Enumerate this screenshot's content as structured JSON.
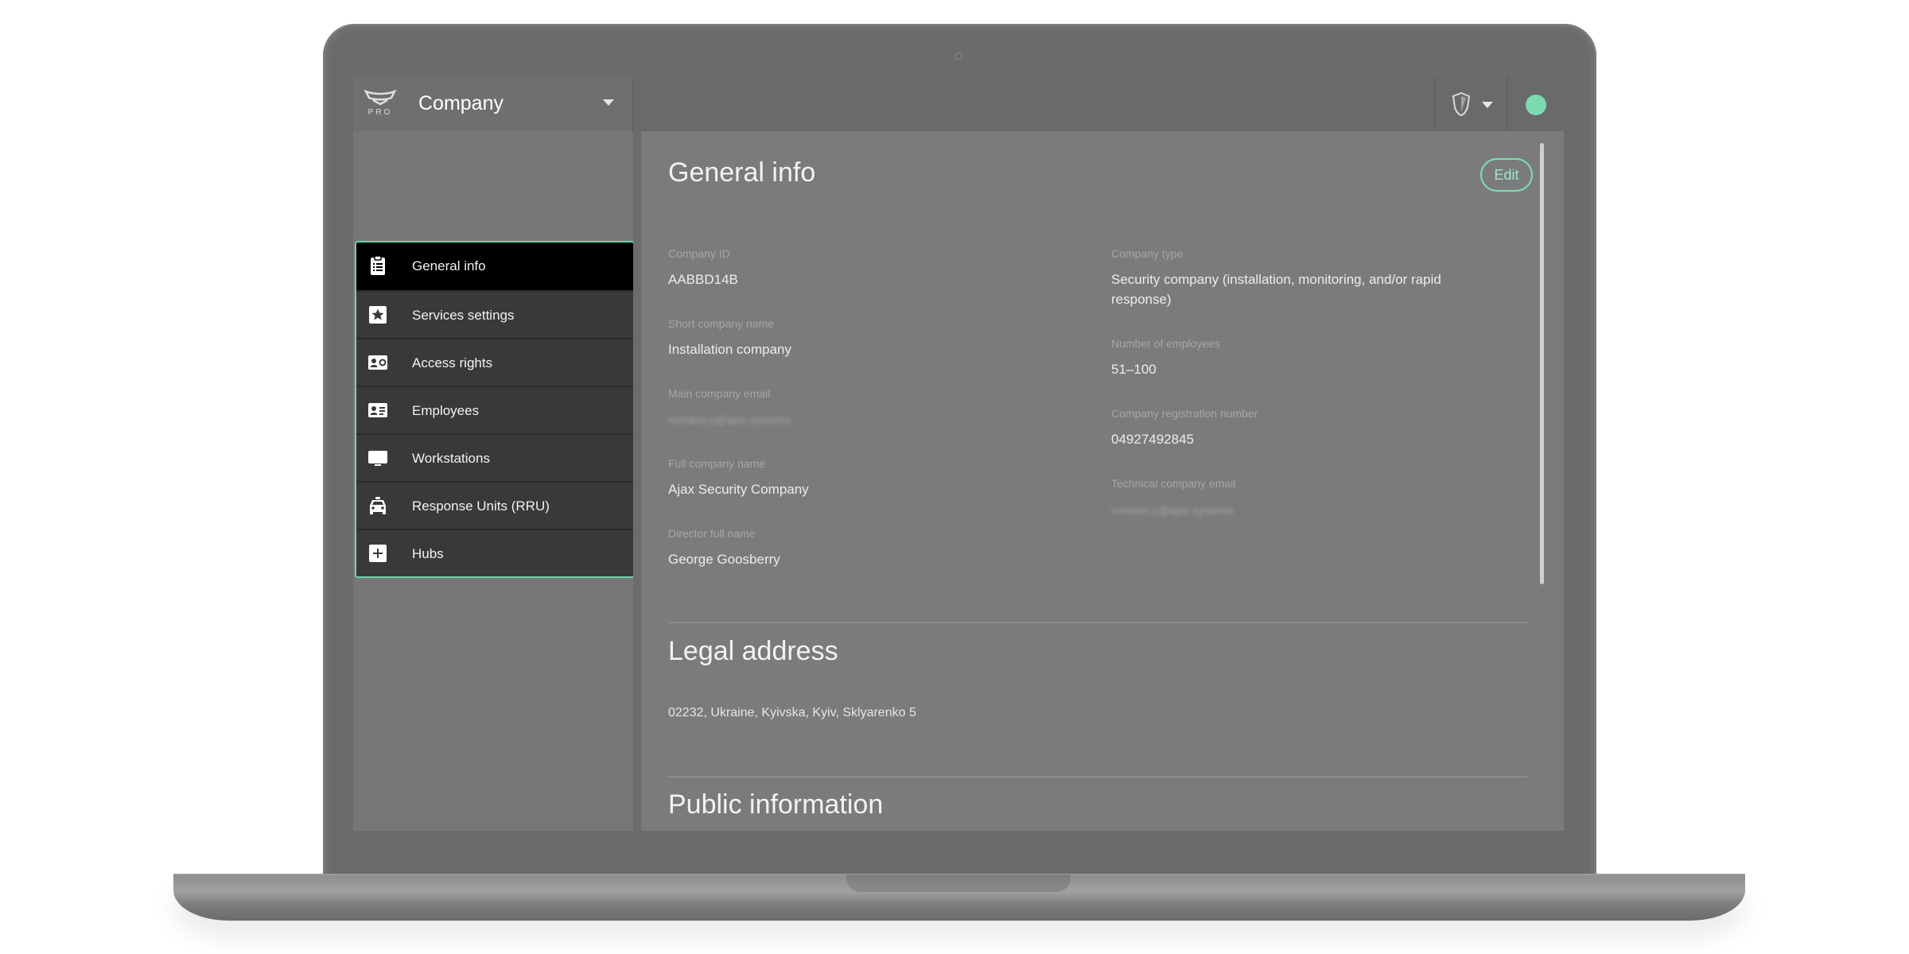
{
  "header": {
    "logo_text": "PRO",
    "company_selector": "Company"
  },
  "sidebar": {
    "items": [
      {
        "label": "General info",
        "icon": "clipboard-icon",
        "active": true
      },
      {
        "label": "Services settings",
        "icon": "star-icon",
        "active": false
      },
      {
        "label": "Access rights",
        "icon": "id-card-icon",
        "active": false
      },
      {
        "label": "Employees",
        "icon": "badge-icon",
        "active": false
      },
      {
        "label": "Workstations",
        "icon": "monitor-icon",
        "active": false
      },
      {
        "label": "Response Units (RRU)",
        "icon": "car-icon",
        "active": false
      },
      {
        "label": "Hubs",
        "icon": "plus-icon",
        "active": false
      }
    ]
  },
  "main": {
    "general_info": {
      "title": "General info",
      "edit_label": "Edit",
      "left_fields": [
        {
          "label": "Company ID",
          "value": "AABBD14B"
        },
        {
          "label": "Short company name",
          "value": "Installation company"
        },
        {
          "label": "Main company email",
          "value": "rochkov.y@ajax.systems"
        },
        {
          "label": "Full company name",
          "value": "Ajax Security Company"
        },
        {
          "label": "Director full name",
          "value": "George Goosberry"
        }
      ],
      "right_fields": [
        {
          "label": "Company type",
          "value": "Security company (installation, monitoring, and/or rapid response)"
        },
        {
          "label": "Number of employees",
          "value": "51–100"
        },
        {
          "label": "Company registration number",
          "value": "04927492845"
        },
        {
          "label": "Technical company email",
          "value": "rochkov.y@ajax.systems"
        }
      ]
    },
    "legal_address": {
      "title": "Legal address",
      "value": "02232, Ukraine, Kyivska, Kyiv, Sklyarenko 5"
    },
    "public_information": {
      "title": "Public information"
    }
  },
  "colors": {
    "accent": "#79dbb1",
    "active_item": "#000000",
    "menu_item": "#393939"
  }
}
